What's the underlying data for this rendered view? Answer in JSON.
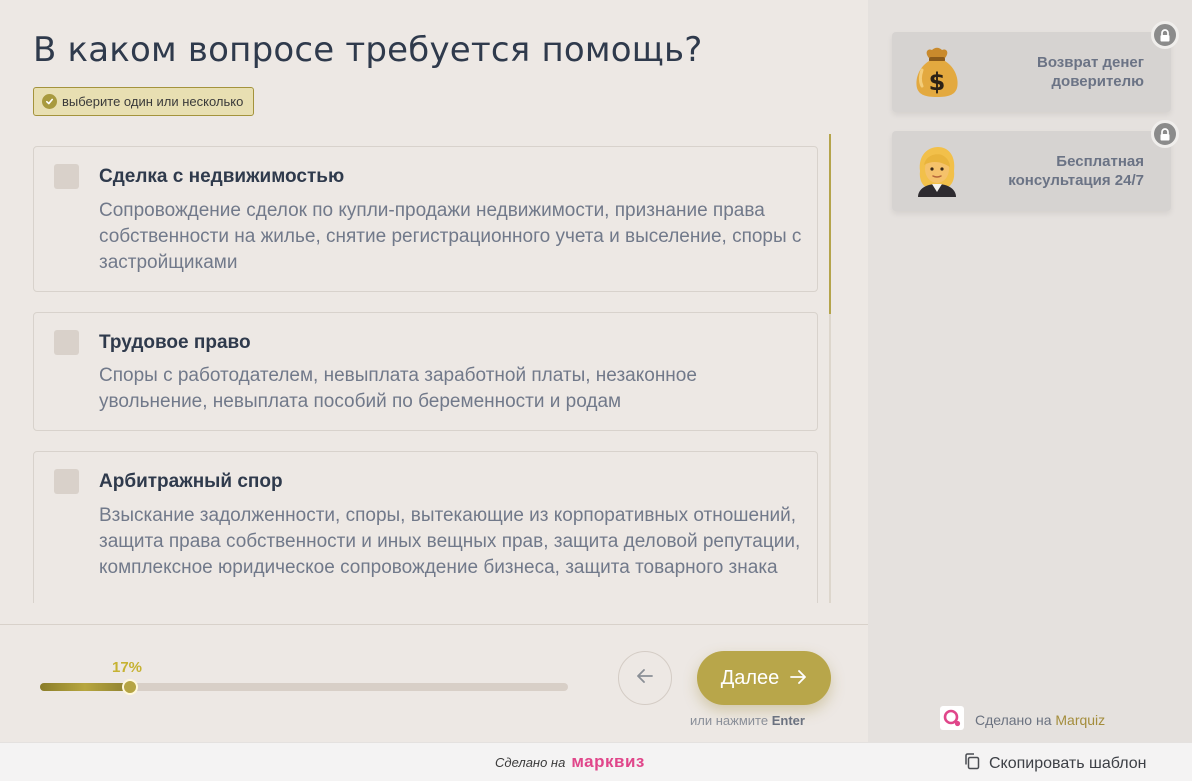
{
  "question": {
    "title": "В каком вопросе требуется помощь?",
    "hint": "выберите один или несколько"
  },
  "options": [
    {
      "title": "Сделка с недвижимостью",
      "description": "Сопровождение сделок по купли-продажи недвижимости, признание права собственности на жилье, снятие регистрационного учета и выселение, споры с застройщиками",
      "checked": false
    },
    {
      "title": "Трудовое право",
      "description": "Споры с работодателем, невыплата заработной платы, незаконное увольнение, невыплата пособий по беременности и родам",
      "checked": false
    },
    {
      "title": "Арбитражный спор",
      "description": "Взыскание задолженности, споры, вытекающие из корпоративных отношений, защита права собственности и иных вещных прав, защита деловой репутации, комплексное юридическое сопровождение бизнеса, защита товарного знака",
      "checked": false
    }
  ],
  "progress": {
    "label": "17%",
    "value": 0.17
  },
  "navigation": {
    "back_icon": "arrow-left-icon",
    "next_label": "Далее",
    "next_icon": "arrow-right-icon",
    "enter_hint_prefix": "или нажмите",
    "enter_key": "Enter"
  },
  "bonuses": [
    {
      "icon": "money-bag-icon",
      "label": "Возврат денег доверителю",
      "locked": true
    },
    {
      "icon": "lawyer-woman-icon",
      "label": "Бесплатная консультация 24/7",
      "locked": true
    }
  ],
  "credit": {
    "prefix": "Сделано на",
    "brand": "Marquiz"
  },
  "footer": {
    "made_with": "Сделано на",
    "logo": "марквиз",
    "copy_label": "Скопировать шаблон"
  },
  "colors": {
    "accent": "#b8a64a",
    "background": "#ede8e4",
    "sidebar": "#e5e1de",
    "logo": "#e0468a"
  }
}
